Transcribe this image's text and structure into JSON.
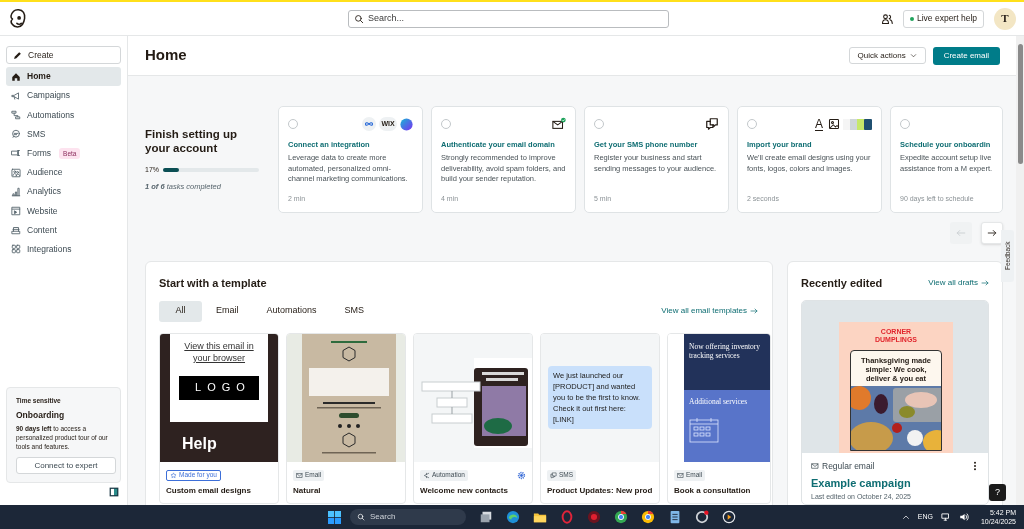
{
  "header": {
    "search_placeholder": "Search...",
    "live_help": "Live expert help",
    "avatar": "T"
  },
  "sidebar": {
    "create": "Create",
    "items": [
      {
        "label": "Home",
        "selected": true
      },
      {
        "label": "Campaigns",
        "selected": false
      },
      {
        "label": "Automations",
        "selected": false
      },
      {
        "label": "SMS",
        "selected": false
      },
      {
        "label": "Forms",
        "selected": false,
        "badge": "Beta"
      },
      {
        "label": "Audience",
        "selected": false
      },
      {
        "label": "Analytics",
        "selected": false
      },
      {
        "label": "Website",
        "selected": false
      },
      {
        "label": "Content",
        "selected": false
      },
      {
        "label": "Integrations",
        "selected": false
      }
    ],
    "onboarding": {
      "eyebrow": "Time sensitive",
      "title": "Onboarding",
      "body": "**90 days left** to access a personalized product tour of our tools and features.",
      "button": "Connect to expert"
    }
  },
  "page": {
    "title": "Home",
    "quick_actions": "Quick actions",
    "create_email": "Create email"
  },
  "setup": {
    "title": "Finish setting up your account",
    "percent": "17%",
    "level": 0.17,
    "tasks": "**1 of 6** tasks completed",
    "cards": [
      {
        "kind": "integration",
        "checked": false,
        "title": "Connect an integration",
        "body": "Leverage data to create more automated, personalized omni-channel marketing communications.",
        "duration": "2 min",
        "logo_text": "WIX"
      },
      {
        "kind": "domain",
        "checked": false,
        "title": "Authenticate your email domain",
        "body": "Strongly recommended to improve deliverability, avoid spam folders, and build your sender reputation.",
        "duration": "4 min"
      },
      {
        "kind": "sms",
        "checked": false,
        "title": "Get your SMS phone number",
        "body": "Register your business and start sending messages to your audience.",
        "duration": "5 min"
      },
      {
        "kind": "brand",
        "checked": false,
        "title": "Import your brand",
        "body": "We'll create email designs using your fonts, logos, colors and images.",
        "duration": "2 seconds",
        "glyph": "A"
      },
      {
        "kind": "schedule",
        "checked": false,
        "title": "Schedule your onboardin",
        "body": "Expedite account setup live assistance from a M expert.",
        "duration": "90 days left to schedule"
      }
    ],
    "prev_disabled": true,
    "next_disabled": false
  },
  "templates": {
    "title": "Start with a template",
    "view_all": "View all email templates",
    "tabs": [
      {
        "label": "All",
        "selected": true
      },
      {
        "label": "Email",
        "selected": false
      },
      {
        "label": "Automations",
        "selected": false
      },
      {
        "label": "SMS",
        "selected": false
      }
    ],
    "cards": [
      {
        "kind": "custom",
        "tag": "Made for you",
        "title": "Custom email designs",
        "link": "View this email in your browser",
        "logo": "LOGO",
        "heading": "Help"
      },
      {
        "kind": "natural",
        "tag": "Email",
        "title": "Natural"
      },
      {
        "kind": "automation",
        "tag": "Automation",
        "title": "Welcome new contacts"
      },
      {
        "kind": "sms",
        "tag": "SMS",
        "title": "Product Updates: New prod",
        "message": "We just launched our [PRODUCT] and wanted you to be the first to know. Check it out first here: [LINK]"
      },
      {
        "kind": "consultation",
        "tag": "Email",
        "title": "Book a consultation",
        "headline": "Now offering inventory tracking services",
        "section": "Additional services"
      }
    ]
  },
  "recent": {
    "title": "Recently edited",
    "view_all": "View all drafts",
    "brand": "CORNER DUMPLINGS",
    "headline": "Thanksgiving made simple: We cook, deliver & you eat",
    "type": "Regular email",
    "name": "Example campaign",
    "edited": "Last edited on October 24, 2025"
  },
  "feedback": "Feedback",
  "help": "?",
  "taskbar": {
    "search": "Search",
    "language": "ENG",
    "time": "5:42 PM",
    "date": "10/24/2025"
  }
}
